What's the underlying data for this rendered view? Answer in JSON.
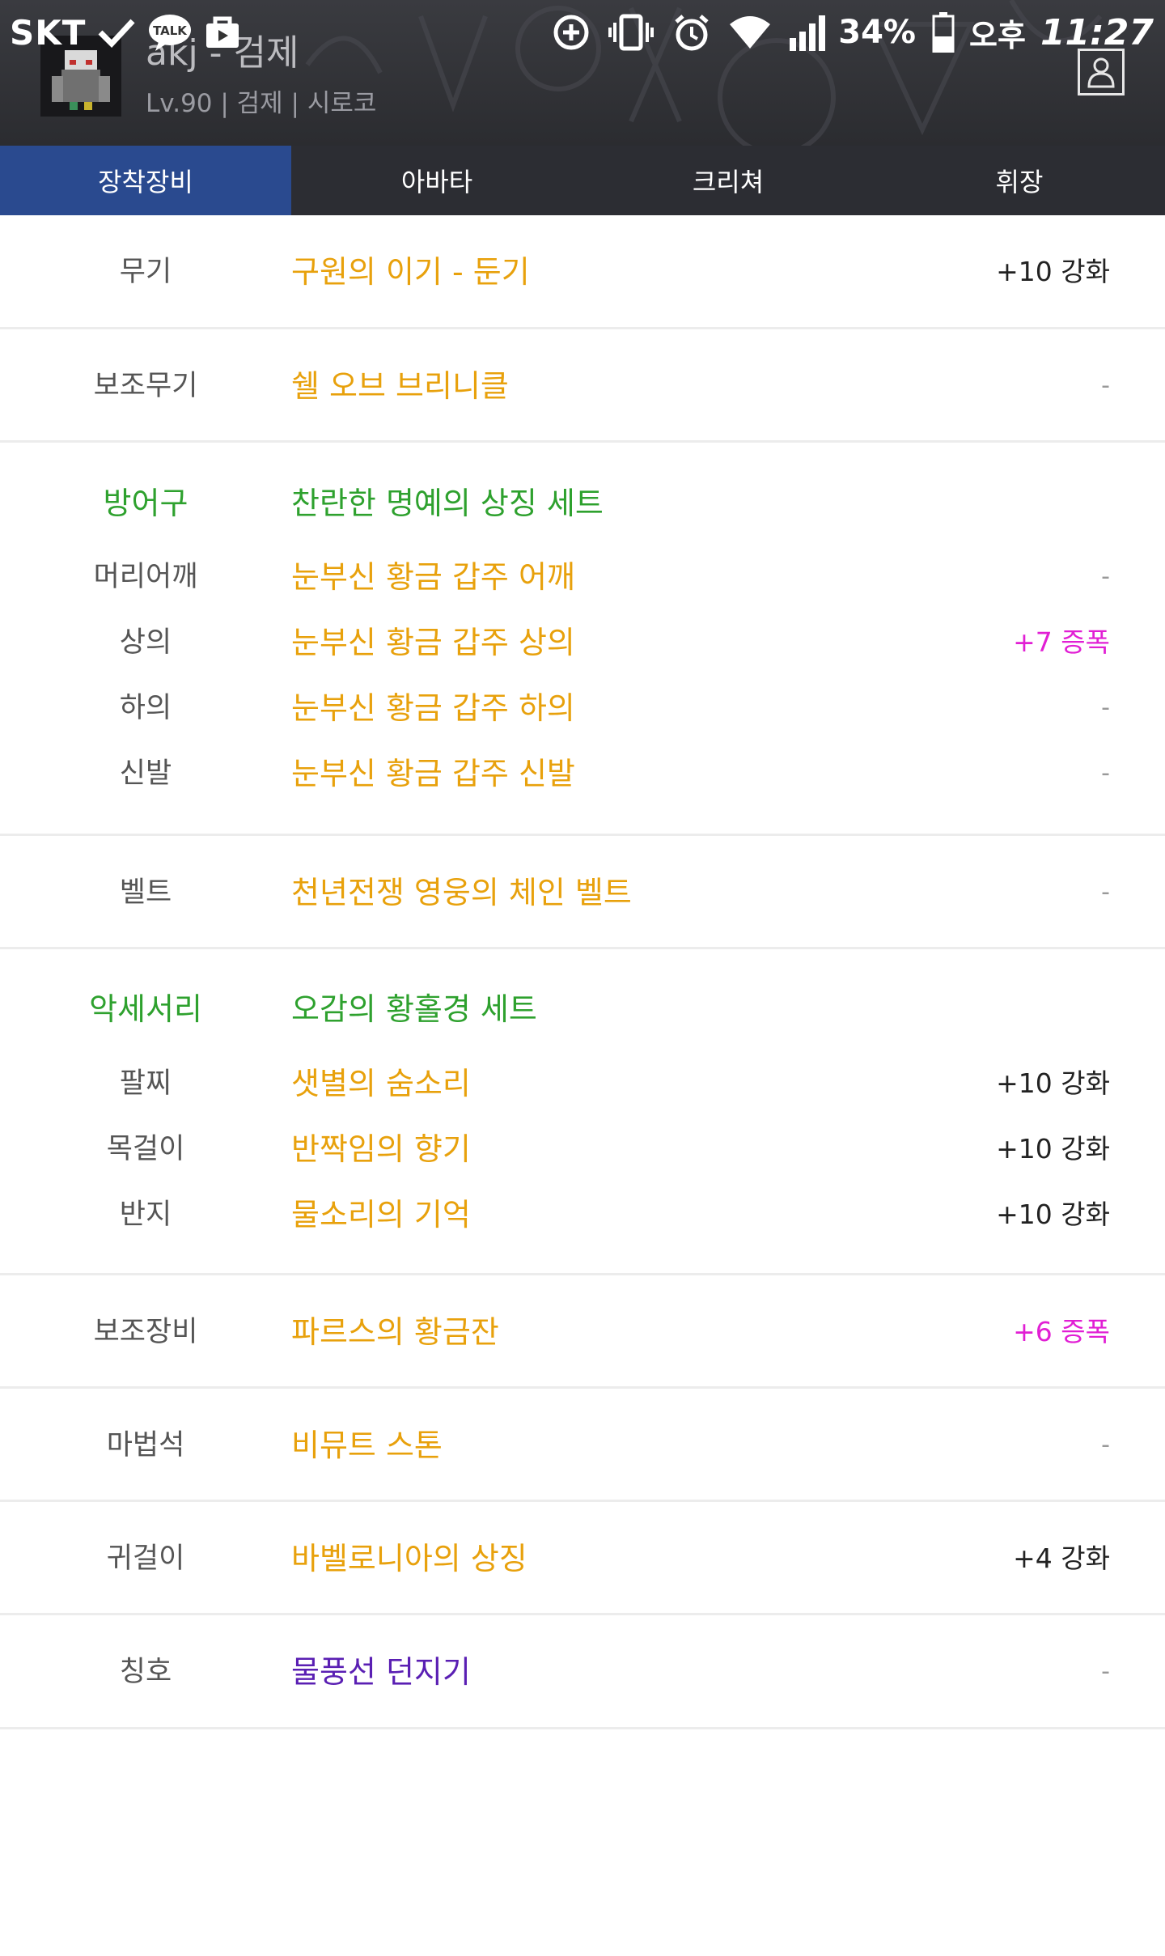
{
  "status_bar": {
    "carrier": "SKT",
    "battery": "34%",
    "ampm": "오후",
    "time": "11:27",
    "icons": [
      "check-icon",
      "talk-icon",
      "bag-icon",
      "data-saver-icon",
      "vibrate-icon",
      "alarm-icon",
      "wifi-icon",
      "signal-icon",
      "battery-icon"
    ]
  },
  "profile": {
    "name": "akj - 검제",
    "info": "Lv.90 | 검제 | 시로코"
  },
  "tabs": [
    {
      "label": "장착장비",
      "active": true
    },
    {
      "label": "아바타",
      "active": false
    },
    {
      "label": "크리쳐",
      "active": false
    },
    {
      "label": "휘장",
      "active": false
    }
  ],
  "equipment": {
    "weapon": {
      "slot": "무기",
      "name": "구원의 이기 - 둔기",
      "value": "+10 강화"
    },
    "sub_weapon": {
      "slot": "보조무기",
      "name": "쉘 오브 브리니클",
      "value": "-"
    },
    "armor": {
      "slot": "방어구",
      "set_name": "찬란한 명예의 상징 세트",
      "items": [
        {
          "slot": "머리어깨",
          "name": "눈부신 황금 갑주 어깨",
          "value": "-"
        },
        {
          "slot": "상의",
          "name": "눈부신 황금 갑주 상의",
          "value": "+7 증폭"
        },
        {
          "slot": "하의",
          "name": "눈부신 황금 갑주 하의",
          "value": "-"
        },
        {
          "slot": "신발",
          "name": "눈부신 황금 갑주 신발",
          "value": "-"
        }
      ]
    },
    "belt": {
      "slot": "벨트",
      "name": "천년전쟁 영웅의 체인 벨트",
      "value": "-"
    },
    "accessory": {
      "slot": "악세서리",
      "set_name": "오감의 황홀경 세트",
      "items": [
        {
          "slot": "팔찌",
          "name": "샛별의 숨소리",
          "value": "+10 강화"
        },
        {
          "slot": "목걸이",
          "name": "반짝임의 향기",
          "value": "+10 강화"
        },
        {
          "slot": "반지",
          "name": "물소리의 기억",
          "value": "+10 강화"
        }
      ]
    },
    "support": {
      "slot": "보조장비",
      "name": "파르스의 황금잔",
      "value": "+6 증폭"
    },
    "magic_stone": {
      "slot": "마법석",
      "name": "비뮤트 스톤",
      "value": "-"
    },
    "earring": {
      "slot": "귀걸이",
      "name": "바벨로니아의 상징",
      "value": "+4 강화"
    },
    "title": {
      "slot": "칭호",
      "name": "물풍선 던지기",
      "value": "-"
    }
  },
  "colors": {
    "item_epic": "#e8a10c",
    "set_green": "#2ea12e",
    "title_purple": "#5a1fb3",
    "amplify": "#e11fd4",
    "tab_active": "#2a4a8f",
    "tab_bar": "#2c2d33"
  }
}
